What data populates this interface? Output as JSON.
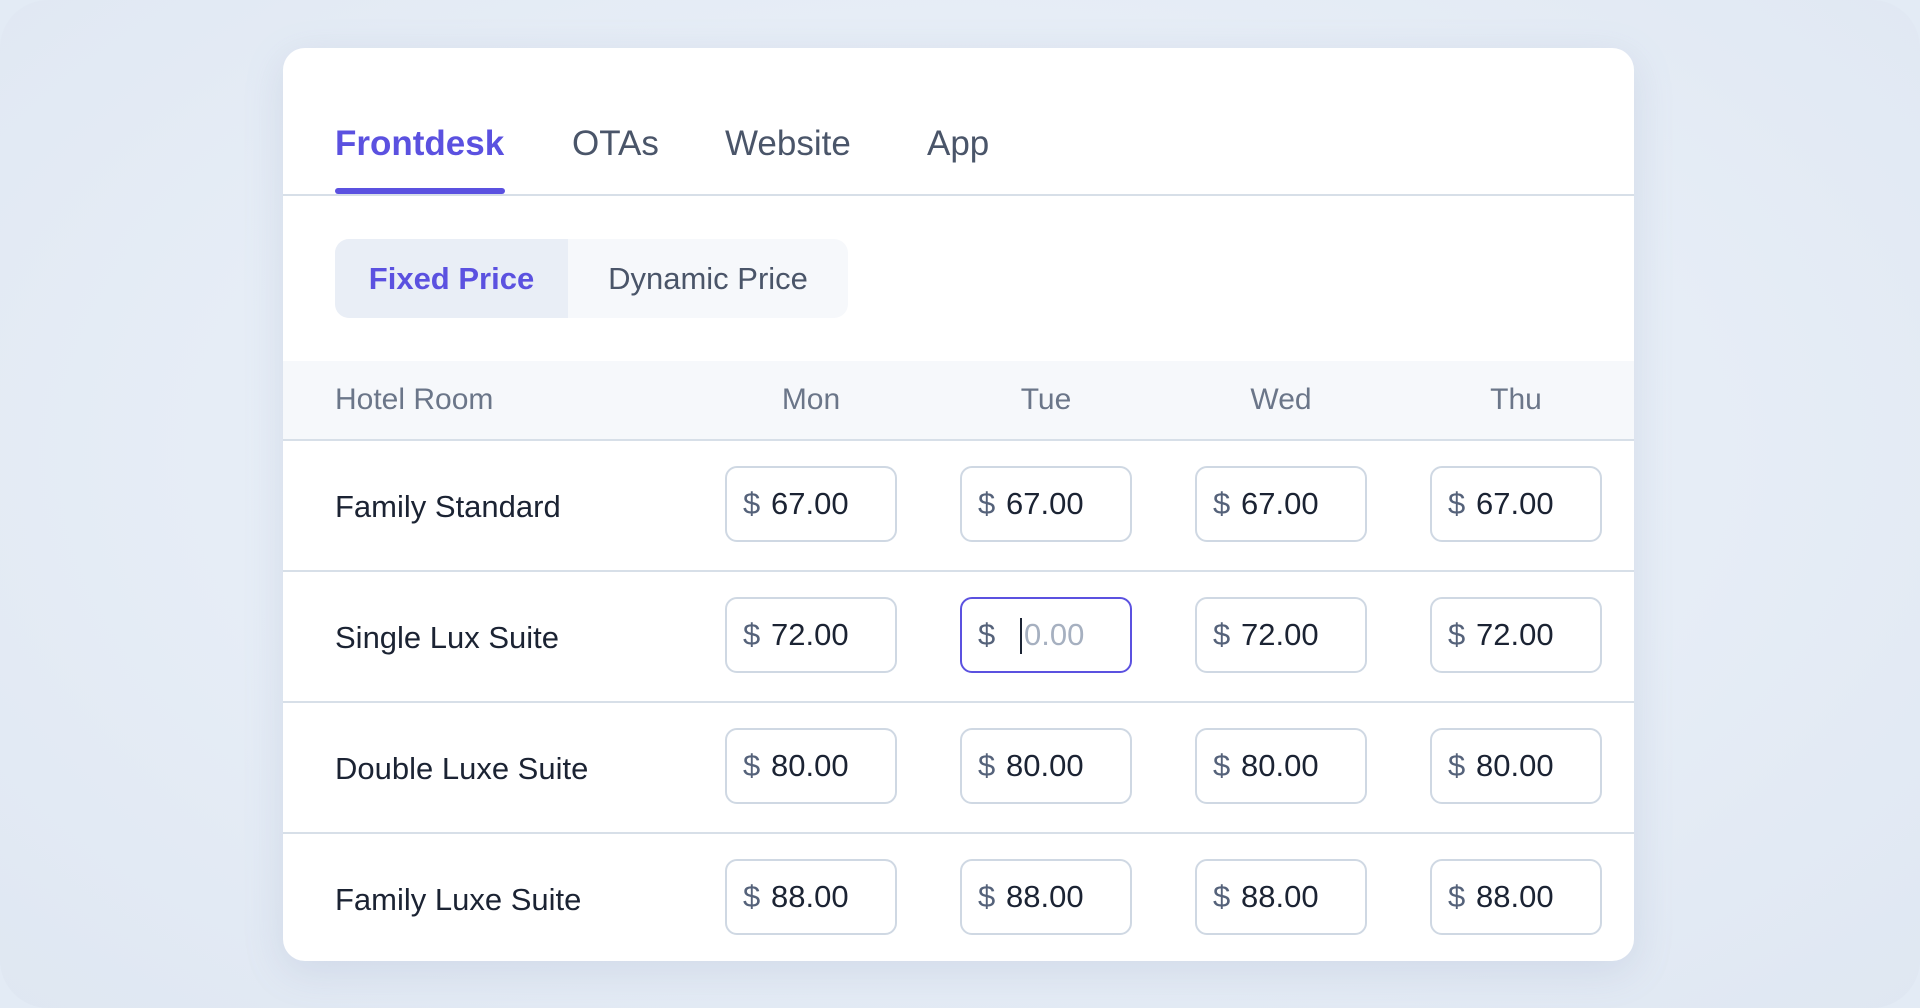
{
  "tabs": [
    {
      "label": "Frontdesk",
      "active": true
    },
    {
      "label": "OTAs",
      "active": false
    },
    {
      "label": "Website",
      "active": false
    },
    {
      "label": "App",
      "active": false
    }
  ],
  "pricing_mode": {
    "options": [
      "Fixed Price",
      "Dynamic Price"
    ],
    "selected": "Fixed Price"
  },
  "table": {
    "room_header": "Hotel Room",
    "days": [
      "Mon",
      "Tue",
      "Wed",
      "Thu"
    ],
    "currency_symbol": "$",
    "rows": [
      {
        "room": "Family Standard",
        "prices": [
          "67.00",
          "67.00",
          "67.00",
          "67.00"
        ]
      },
      {
        "room": "Single Lux Suite",
        "prices": [
          "72.00",
          "",
          "72.00",
          "72.00"
        ],
        "placeholders": [
          "",
          "0.00",
          "",
          ""
        ]
      },
      {
        "room": "Double Luxe Suite",
        "prices": [
          "80.00",
          "80.00",
          "80.00",
          "80.00"
        ]
      },
      {
        "room": "Family Luxe Suite",
        "prices": [
          "88.00",
          "88.00",
          "88.00",
          "88.00"
        ]
      }
    ]
  },
  "colors": {
    "accent": "#5b51e0",
    "text_primary": "#1b2333",
    "text_secondary": "#4a5569",
    "border": "#cfd8e3",
    "header_bg": "#f6f8fb",
    "page_bg": "#e3ebf5"
  }
}
